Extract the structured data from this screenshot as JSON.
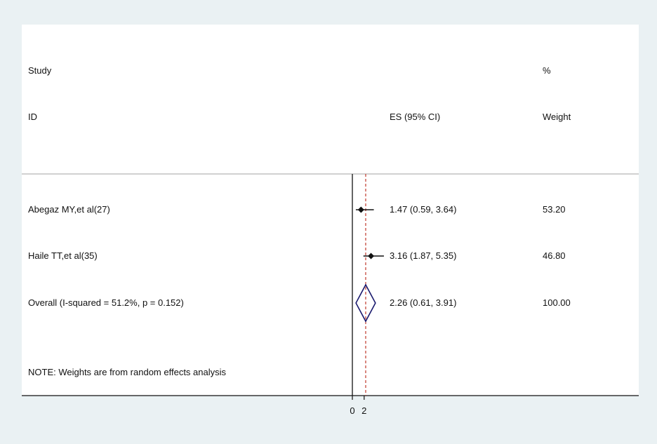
{
  "chart_data": {
    "type": "forest",
    "headers": {
      "study_line1": "Study",
      "study_line2": "ID",
      "es": "ES (95% CI)",
      "weight_line1": "%",
      "weight_line2": "Weight"
    },
    "studies": [
      {
        "id": "Abegaz MY,et al(27)",
        "es": 1.47,
        "lo": 0.59,
        "hi": 3.64,
        "es_label": "1.47 (0.59, 3.64)",
        "weight": "53.20"
      },
      {
        "id": "Haile TT,et al(35)",
        "es": 3.16,
        "lo": 1.87,
        "hi": 5.35,
        "es_label": "3.16 (1.87, 5.35)",
        "weight": "46.80"
      }
    ],
    "overall": {
      "label": "Overall  (I-squared = 51.2%, p = 0.152)",
      "es": 2.26,
      "lo": 0.61,
      "hi": 3.91,
      "es_label": "2.26 (0.61, 3.91)",
      "weight": "100.00"
    },
    "note": "NOTE: Weights are from random effects analysis",
    "x_ticks": [
      0,
      2
    ],
    "null_line": 0,
    "overall_line": 2.26,
    "colors": {
      "diamond": "#1a1a6e",
      "overall_line": "#c0392b",
      "marker": "#111111"
    }
  }
}
